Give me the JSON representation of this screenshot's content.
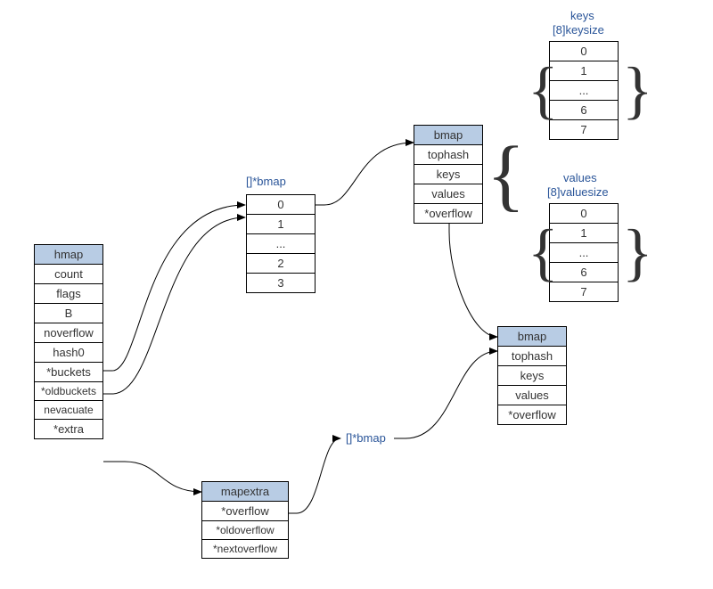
{
  "titles": {
    "keys": "keys",
    "keysize": "[8]keysize",
    "values": "values",
    "valuesize": "[8]valuesize",
    "bmap_array1": "[]*bmap",
    "bmap_array2": "[]*bmap"
  },
  "hmap": {
    "head": "hmap",
    "fields": [
      "count",
      "flags",
      "B",
      "noverflow",
      "hash0",
      "*buckets",
      "*oldbuckets",
      "nevacuate",
      "*extra"
    ]
  },
  "mapextra": {
    "head": "mapextra",
    "fields": [
      "*overflow",
      "*oldoverflow",
      "*nextoverflow"
    ]
  },
  "bmap_array1": {
    "fields": [
      "0",
      "1",
      "...",
      "2",
      "3"
    ]
  },
  "bmap1": {
    "head": "bmap",
    "fields": [
      "tophash",
      "keys",
      "values",
      "*overflow"
    ]
  },
  "bmap2": {
    "head": "bmap",
    "fields": [
      "tophash",
      "keys",
      "values",
      "*overflow"
    ]
  },
  "keys_arr": {
    "fields": [
      "0",
      "1",
      "...",
      "6",
      "7"
    ]
  },
  "values_arr": {
    "fields": [
      "0",
      "1",
      "...",
      "6",
      "7"
    ]
  }
}
